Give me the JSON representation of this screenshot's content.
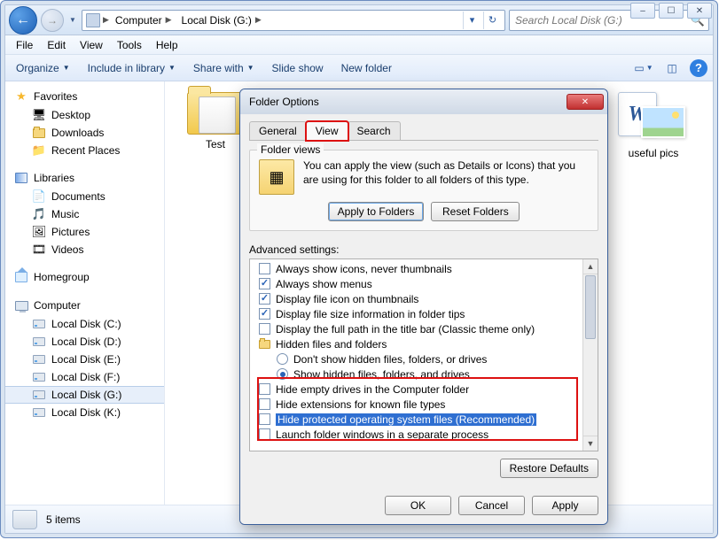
{
  "window_controls": {
    "min": "–",
    "max": "☐",
    "close": "✕"
  },
  "breadcrumb": {
    "root": "Computer",
    "drive": "Local Disk (G:)"
  },
  "search": {
    "placeholder": "Search Local Disk (G:)"
  },
  "menu": [
    "File",
    "Edit",
    "View",
    "Tools",
    "Help"
  ],
  "toolbar": {
    "organize": "Organize",
    "include": "Include in library",
    "share": "Share with",
    "slide": "Slide show",
    "newfolder": "New folder"
  },
  "nav": {
    "favorites": "Favorites",
    "fav_items": [
      "Desktop",
      "Downloads",
      "Recent Places"
    ],
    "libraries": "Libraries",
    "lib_items": [
      "Documents",
      "Music",
      "Pictures",
      "Videos"
    ],
    "homegroup": "Homegroup",
    "computer": "Computer",
    "drives": [
      "Local Disk (C:)",
      "Local Disk (D:)",
      "Local Disk (E:)",
      "Local Disk (F:)",
      "Local Disk (G:)",
      "Local Disk (K:)"
    ]
  },
  "files": {
    "item1": "Test",
    "item2": "useful pics"
  },
  "status": {
    "count": "5 items"
  },
  "dialog": {
    "title": "Folder Options",
    "tabs": [
      "General",
      "View",
      "Search"
    ],
    "group_legend": "Folder views",
    "fv_text": "You can apply the view (such as Details or Icons) that you are using for this folder to all folders of this type.",
    "apply_folders": "Apply to Folders",
    "reset_folders": "Reset Folders",
    "advanced_label": "Advanced settings:",
    "items": [
      {
        "kind": "cb",
        "checked": false,
        "text": "Always show icons, never thumbnails"
      },
      {
        "kind": "cb",
        "checked": true,
        "text": "Always show menus"
      },
      {
        "kind": "cb",
        "checked": true,
        "text": "Display file icon on thumbnails"
      },
      {
        "kind": "cb",
        "checked": true,
        "text": "Display file size information in folder tips"
      },
      {
        "kind": "cb",
        "checked": false,
        "text": "Display the full path in the title bar (Classic theme only)"
      },
      {
        "kind": "hdr",
        "text": "Hidden files and folders"
      },
      {
        "kind": "rb",
        "checked": false,
        "indent": true,
        "text": "Don't show hidden files, folders, or drives"
      },
      {
        "kind": "rb",
        "checked": true,
        "indent": true,
        "text": "Show hidden files, folders, and drives"
      },
      {
        "kind": "cb",
        "checked": false,
        "text": "Hide empty drives in the Computer folder"
      },
      {
        "kind": "cb",
        "checked": false,
        "text": "Hide extensions for known file types"
      },
      {
        "kind": "cb",
        "checked": false,
        "highlight": true,
        "text": "Hide protected operating system files (Recommended)"
      },
      {
        "kind": "cb",
        "checked": false,
        "text": "Launch folder windows in a separate process"
      }
    ],
    "restore": "Restore Defaults",
    "ok": "OK",
    "cancel": "Cancel",
    "apply": "Apply"
  }
}
